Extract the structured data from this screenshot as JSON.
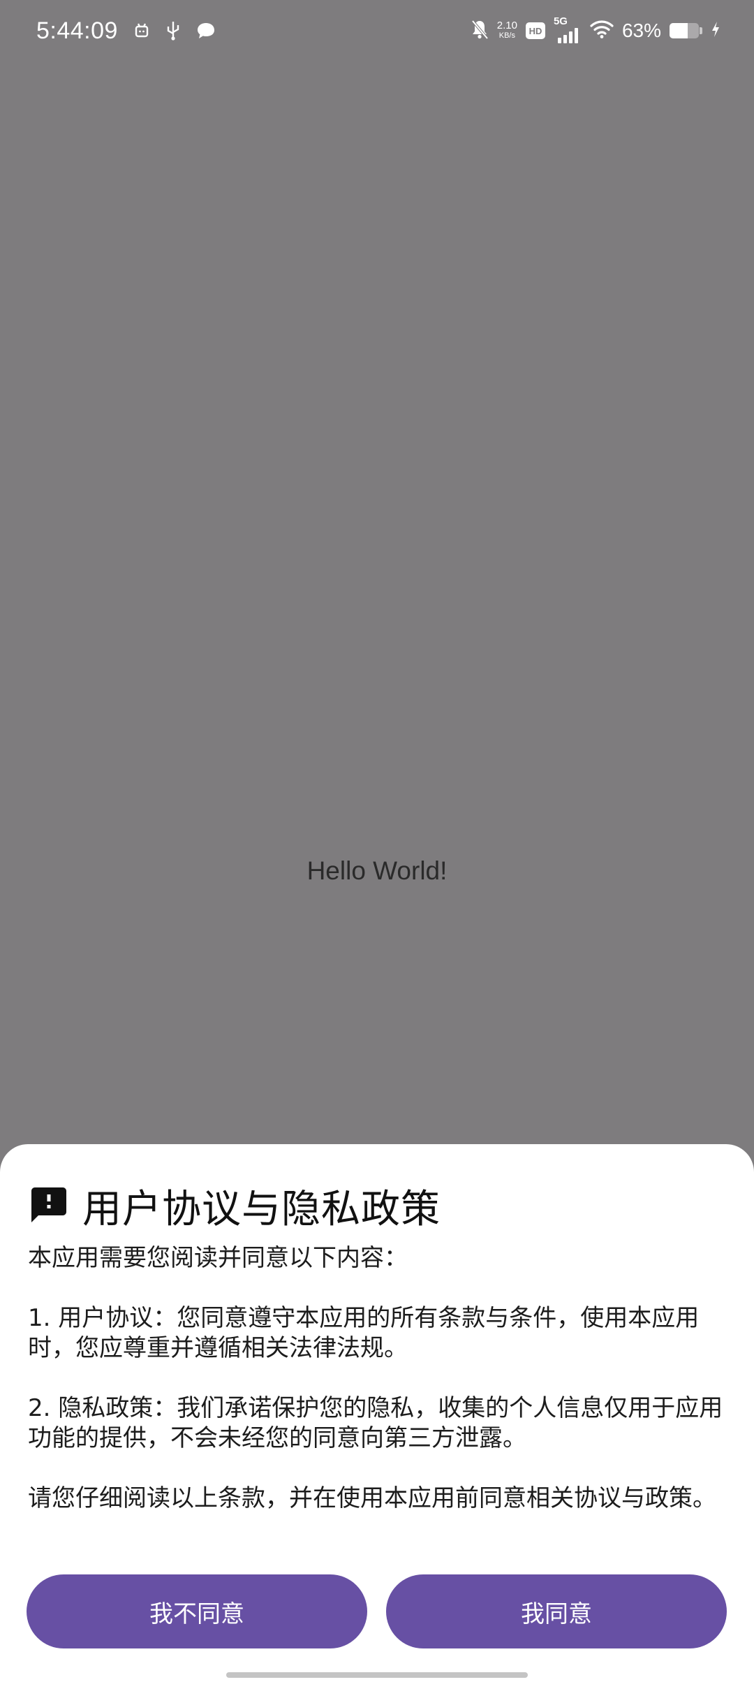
{
  "status_bar": {
    "time": "5:44:09",
    "net_speed_value": "2.10",
    "net_speed_unit": "KB/s",
    "hd_label": "HD",
    "network_type": "5G",
    "battery_percent": "63%",
    "battery_level": 0.63,
    "left_icons": [
      "alarm-icon",
      "usb-icon",
      "chat-bubble-icon"
    ],
    "right_icons": [
      "bell-off-icon",
      "signal-icon",
      "wifi-icon",
      "battery-icon",
      "charging-bolt-icon"
    ]
  },
  "main": {
    "hello_text": "Hello World!"
  },
  "sheet": {
    "icon": "feedback-alert-icon",
    "title": "用户协议与隐私政策",
    "intro": "本应用需要您阅读并同意以下内容：",
    "item1": " 1. 用户协议：您同意遵守本应用的所有条款与条件，使用本应用时，您应尊重并遵循相关法律法规。",
    "item2": " 2. 隐私政策：我们承诺保护您的隐私，收集的个人信息仅用于应用功能的提供，不会未经您的同意向第三方泄露。",
    "closing": " 请您仔细阅读以上条款，并在使用本应用前同意相关协议与政策。",
    "disagree_label": "我不同意",
    "agree_label": "我同意",
    "accent_color": "#6750a4"
  }
}
